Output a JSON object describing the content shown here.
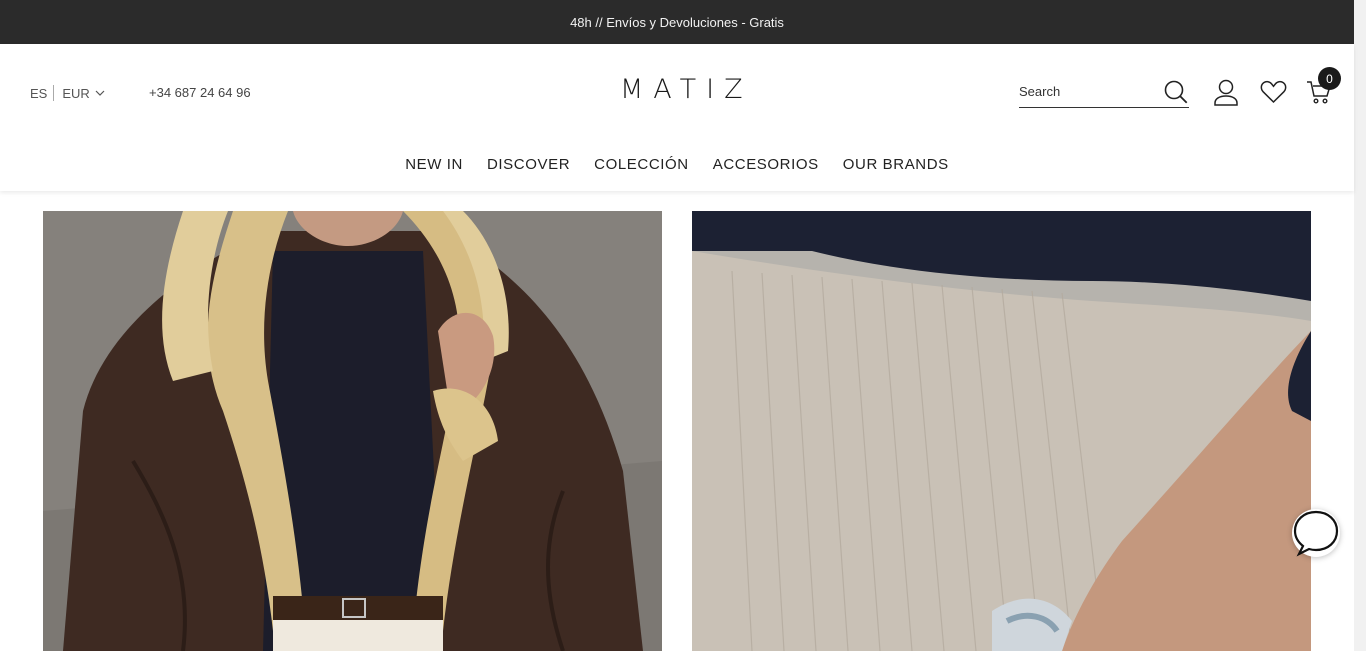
{
  "announcement": {
    "text": "48h // Envíos y Devoluciones - Gratis"
  },
  "header": {
    "language": "ES",
    "currency": "EUR",
    "phone": "+34 687 24 64 96",
    "logo": "MATIZ",
    "search": {
      "placeholder": "Search",
      "value": ""
    },
    "cart_count": "0",
    "icons": [
      "search-icon",
      "account-icon",
      "wishlist-heart-icon",
      "cart-icon",
      "chevron-down-icon"
    ]
  },
  "nav": {
    "items": [
      {
        "label": "NEW IN"
      },
      {
        "label": "DISCOVER"
      },
      {
        "label": "COLECCIÓN"
      },
      {
        "label": "ACCESORIOS"
      },
      {
        "label": "OUR BRANDS"
      }
    ]
  },
  "content": {
    "images": [
      {
        "name": "shearling-jacket-photo"
      },
      {
        "name": "knit-sweater-bracelet-photo"
      }
    ]
  },
  "colors": {
    "announcement_bg": "#2b2b2b",
    "text": "#222222",
    "badge": "#1a1a1a"
  }
}
